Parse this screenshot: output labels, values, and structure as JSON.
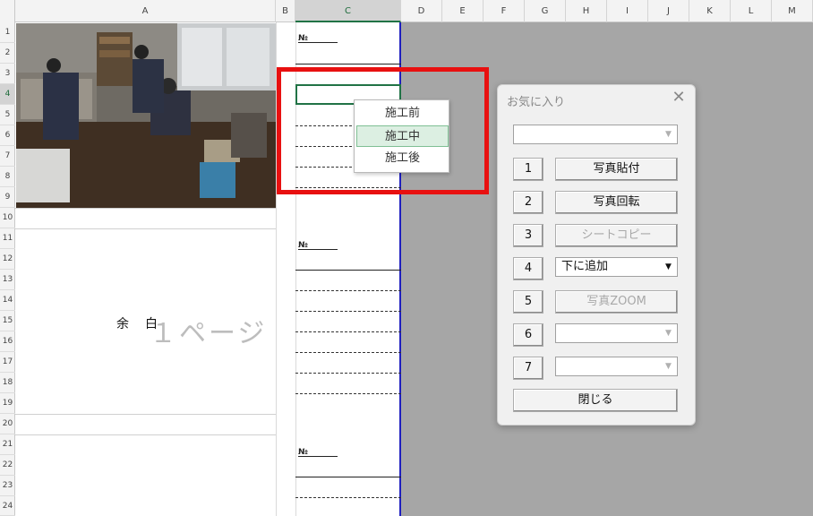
{
  "columns": [
    "A",
    "B",
    "C",
    "D",
    "E",
    "F",
    "G",
    "H",
    "I",
    "J",
    "K",
    "L",
    "M"
  ],
  "rows": [
    "1",
    "2",
    "3",
    "4",
    "5",
    "6",
    "7",
    "8",
    "9",
    "10",
    "11",
    "12",
    "13",
    "14",
    "15",
    "16",
    "17",
    "18",
    "19",
    "20",
    "21",
    "22",
    "23",
    "24"
  ],
  "selected_column": "C",
  "selected_row": "4",
  "sheet": {
    "no_mark": "№",
    "blank_label": "余　白",
    "page_watermark": "１ページ"
  },
  "dropdown": {
    "items": [
      "施工前",
      "施工中",
      "施工後"
    ],
    "highlighted": "施工中"
  },
  "dialog": {
    "title": "お気に入り",
    "close": "✕",
    "top_combo_value": "",
    "rows": [
      {
        "num": "1",
        "label": "写真貼付",
        "kind": "button",
        "enabled": true
      },
      {
        "num": "2",
        "label": "写真回転",
        "kind": "button",
        "enabled": true
      },
      {
        "num": "3",
        "label": "シートコピー",
        "kind": "button",
        "enabled": false
      },
      {
        "num": "4",
        "label": "下に追加",
        "kind": "combo",
        "enabled": true
      },
      {
        "num": "5",
        "label": "写真ZOOM",
        "kind": "button",
        "enabled": false
      },
      {
        "num": "6",
        "label": "",
        "kind": "combo",
        "enabled": false
      },
      {
        "num": "7",
        "label": "",
        "kind": "combo",
        "enabled": false
      }
    ],
    "close_button": "閉じる"
  },
  "colors": {
    "accent_green": "#217346",
    "highlight_red": "#e81010",
    "print_border_blue": "#1f1fbf"
  }
}
